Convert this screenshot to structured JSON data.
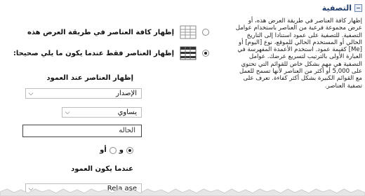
{
  "section": {
    "title": "التصفية",
    "icon": "collapse-icon"
  },
  "description": "إظهار كافة العناصر في طريقة العرض هذه، أو عرض مجموعة فرعية من العناصر باستخدام عوامل التصفية. للتصفية على عمود استنادا إلى التاريخ الحالي أو المستخدم الحالي للموقع، نوع [اليوم] أو [Me] كقيمة عمود. استخدم الأعمدة المفهرسة في العبارة الأولى بالترتيب لتسريع عرضك. عوامل التصفية هي مهم بشكل خاص للقوائم التي تحتوي على 5,000 أو أكثر من العناصر لأنها تسمح للعمل مع القوائم الكبيرة بشكل أكثر كفاءة. تعرف على تصفية العناصر.",
  "options": {
    "show_all": {
      "label": "إظهار كافة العناصر في طريقة العرض هذه",
      "icon": "list-grid-icon",
      "selected": false
    },
    "show_filtered": {
      "label": "إظهار العناصر فقط عندما يكون ما يلي صحيحا:",
      "icon": "filtered-grid-icon",
      "selected": true
    }
  },
  "filter": {
    "column_label": "إظهار العناصر عند العمود",
    "column_value": "الإصدار",
    "operator_value": "يساوي",
    "value_text": "الحاله",
    "andor": {
      "and_label": "و",
      "or_label": "أو",
      "and_selected": true
    },
    "second_column_label": "عندما يكون العمود",
    "second_column_value": "Rela ase"
  }
}
